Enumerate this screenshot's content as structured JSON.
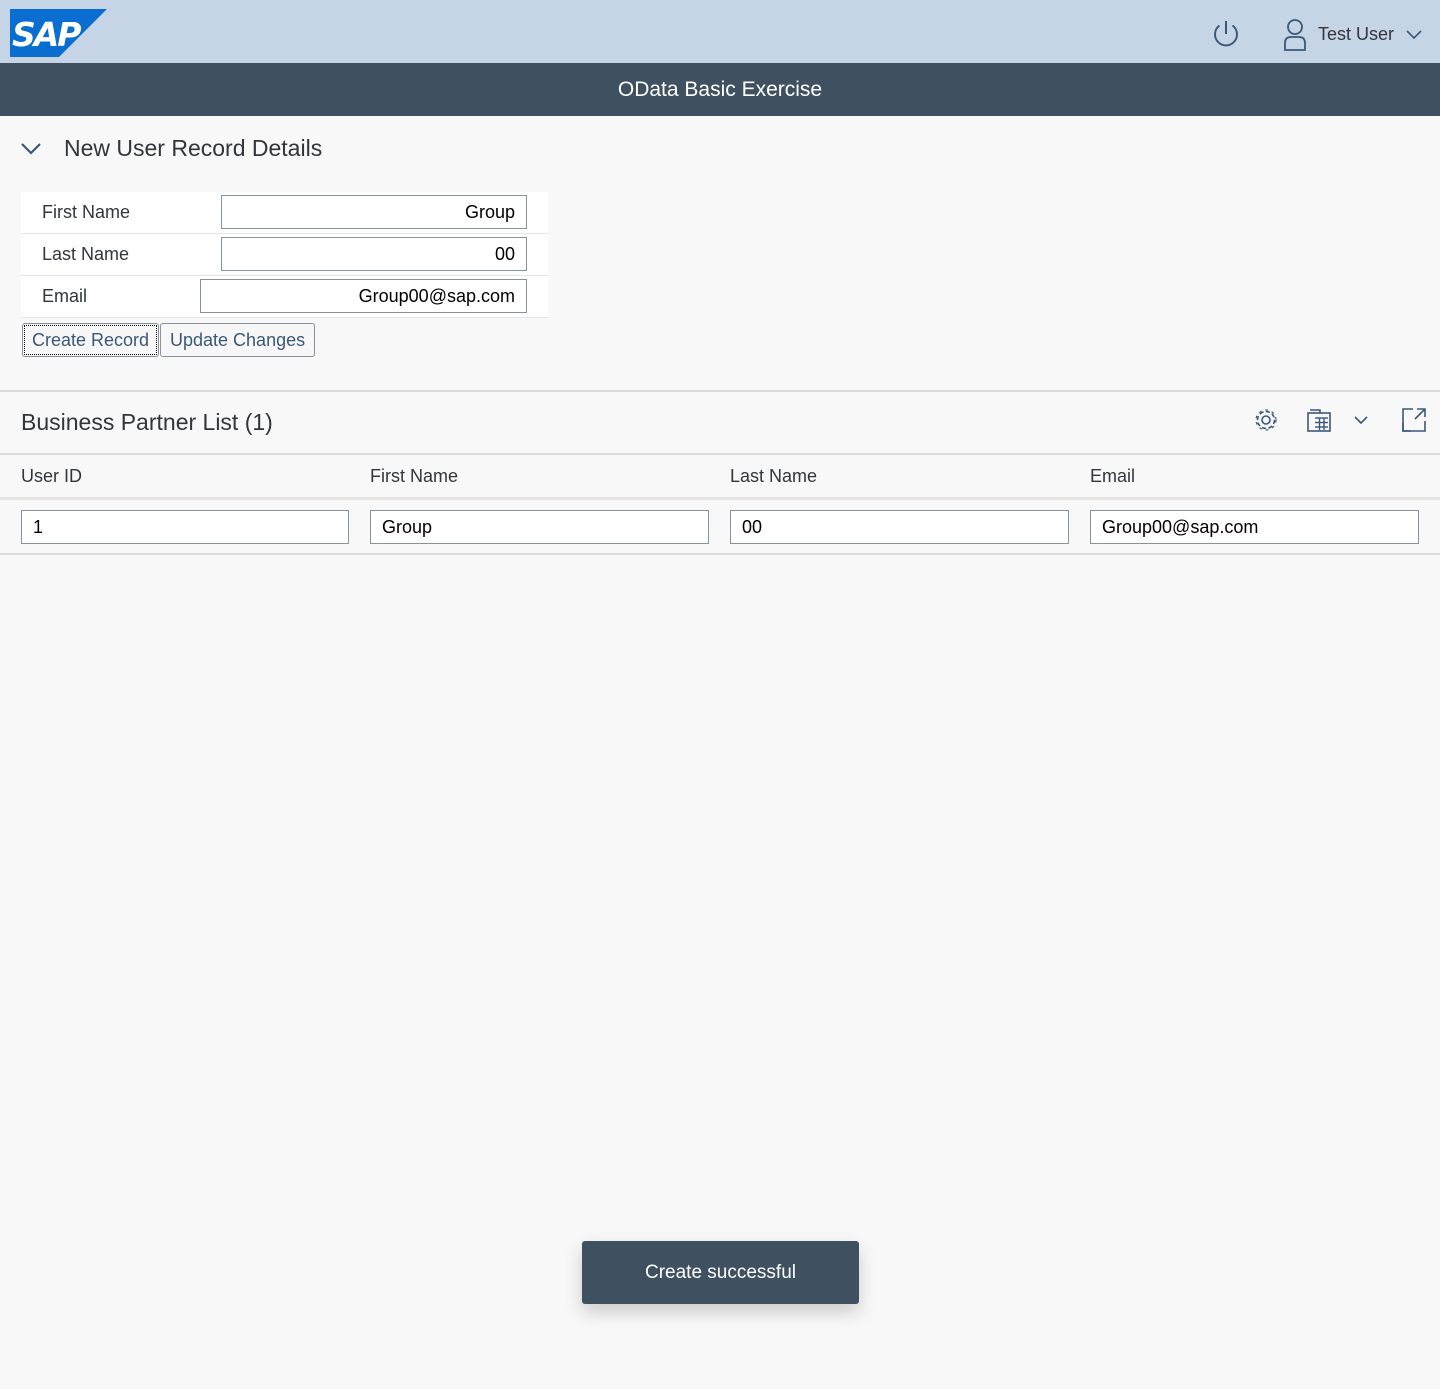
{
  "shell": {
    "logo_text": "SAP",
    "user_name": "Test User",
    "icons": {
      "power": "power-icon",
      "user": "user-icon",
      "dropdown": "chevron-down-icon"
    }
  },
  "app": {
    "title": "OData Basic Exercise"
  },
  "form_panel": {
    "title": "New User Record Details",
    "fields": [
      {
        "label": "First Name",
        "value": "Group"
      },
      {
        "label": "Last Name",
        "value": "00"
      },
      {
        "label": "Email",
        "value": "Group00@sap.com"
      }
    ],
    "buttons": {
      "create": "Create Record",
      "update": "Update Changes"
    }
  },
  "table": {
    "title": "Business Partner List (1)",
    "toolbar_icons": [
      "gear-icon",
      "export-spreadsheet-icon",
      "chevron-down-icon",
      "fullscreen-icon"
    ],
    "columns": [
      "User ID",
      "First Name",
      "Last Name",
      "Email"
    ],
    "rows": [
      [
        "1",
        "Group",
        "00",
        "Group00@sap.com"
      ]
    ]
  },
  "toast": {
    "message": "Create successful"
  },
  "colors": {
    "shell_bg": "#c5d5e6",
    "title_bar_bg": "#3f5060",
    "page_bg": "#f8f8f8",
    "logo_blue": "#0a6ed1",
    "button_text": "#3a5879"
  }
}
